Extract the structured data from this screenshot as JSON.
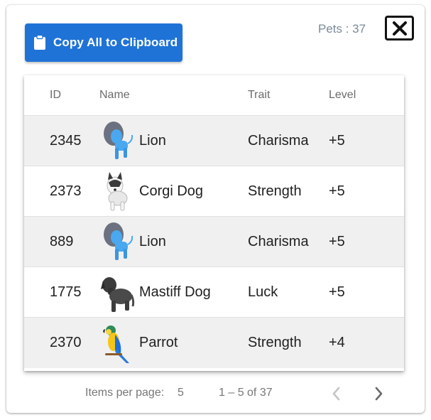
{
  "toolbar": {
    "copy_label": "Copy All to Clipboard",
    "pets_count": "Pets : 37",
    "copy_icon": "clipboard-icon",
    "close_icon": "close-icon"
  },
  "table": {
    "headers": {
      "id": "ID",
      "name": "Name",
      "trait": "Trait",
      "level": "Level"
    },
    "rows": [
      {
        "id": "2345",
        "name": "Lion",
        "trait": "Charisma",
        "level": "+5",
        "icon": "lion-icon"
      },
      {
        "id": "2373",
        "name": "Corgi Dog",
        "trait": "Strength",
        "level": "+5",
        "icon": "corgi-icon"
      },
      {
        "id": "889",
        "name": "Lion",
        "trait": "Charisma",
        "level": "+5",
        "icon": "lion-icon"
      },
      {
        "id": "1775",
        "name": "Mastiff Dog",
        "trait": "Luck",
        "level": "+5",
        "icon": "mastiff-icon"
      },
      {
        "id": "2370",
        "name": "Parrot",
        "trait": "Strength",
        "level": "+4",
        "icon": "parrot-icon"
      }
    ]
  },
  "pagination": {
    "items_per_page_label": "Items per page:",
    "page_size": "5",
    "range": "1 – 5 of 37"
  },
  "colors": {
    "accent": "#1f73d6",
    "shaded_row": "#f0f0f0",
    "lion_blue": "#4aa8f0"
  }
}
